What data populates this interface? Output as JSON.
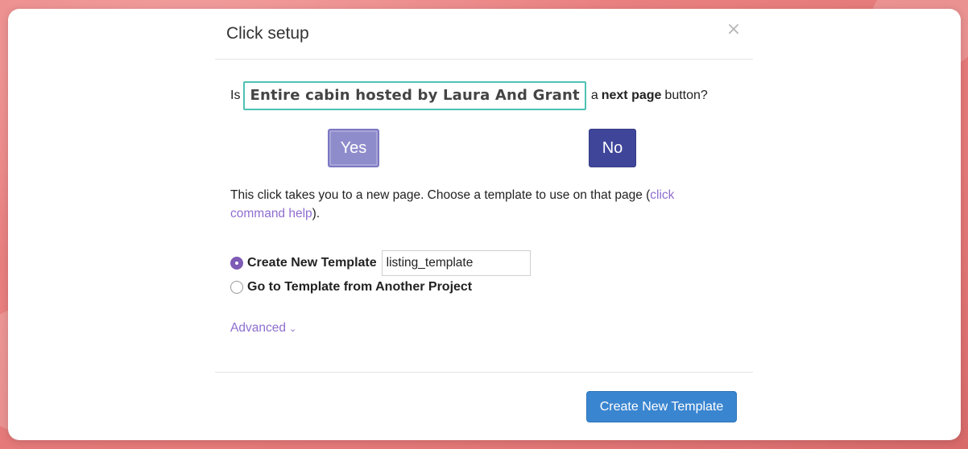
{
  "modal": {
    "title": "Click setup",
    "close_glyph": "×"
  },
  "question": {
    "prefix": "Is",
    "element_text": "Entire cabin hosted by Laura And Grant",
    "middle": "a",
    "bold": "next page",
    "suffix": "button?"
  },
  "buttons": {
    "yes_label": "Yes",
    "no_label": "No",
    "create_label": "Create New Template"
  },
  "info": {
    "text": "This click takes you to a new page. Choose a template to use on that page (",
    "link": "click command help",
    "end": ")."
  },
  "options": {
    "create_new_label": "Create New Template",
    "create_new_value": "listing_template",
    "another_project_label": "Go to Template from Another Project",
    "selected": "create_new"
  },
  "advanced": {
    "label": "Advanced",
    "chevron": "⌄"
  },
  "colors": {
    "accent_purple": "#8f6ecf",
    "highlight_teal": "#4fc1b3",
    "no_button": "#3f469a",
    "yes_button": "#8f8ccc",
    "primary_blue": "#3a85d0"
  },
  "icons": {
    "close": "close-icon",
    "chevron": "chevron-down-icon",
    "radio_checked": "radio-checked-icon",
    "radio_unchecked": "radio-unchecked-icon"
  }
}
